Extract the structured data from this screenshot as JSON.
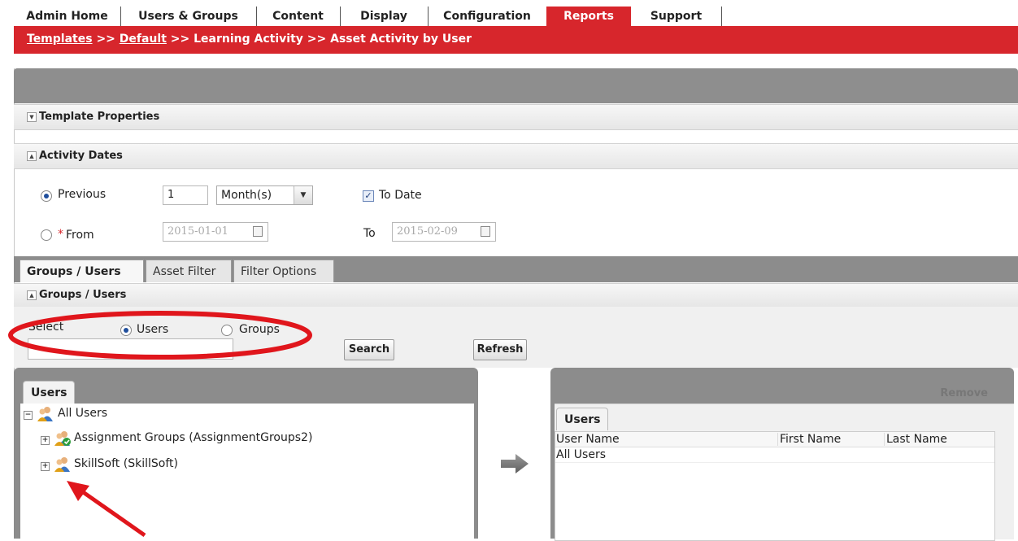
{
  "nav": {
    "tabs": [
      "Admin Home",
      "Users & Groups",
      "Content",
      "Display",
      "Configuration",
      "Reports",
      "Support"
    ],
    "active": "Reports"
  },
  "breadcrumb": {
    "templates": "Templates",
    "sep1": ">>",
    "default": "Default",
    "sep2": ">>",
    "learning": "Learning Activity",
    "sep3": ">>",
    "current": "Asset Activity by User"
  },
  "sections": {
    "template_properties": "Template Properties",
    "activity_dates": "Activity Dates",
    "groups_users": "Groups / Users"
  },
  "dates": {
    "previous_label": "Previous",
    "previous_value": "1",
    "period_selected": "Month(s)",
    "to_date_label": "To Date",
    "from_required": "*",
    "from_label": "From",
    "from_value": "2015-01-01",
    "to_label": "To",
    "to_value": "2015-02-09"
  },
  "tabs": [
    "Groups / Users",
    "Asset Filter",
    "Filter Options"
  ],
  "filter": {
    "select_label": "Select",
    "users_label": "Users",
    "groups_label": "Groups",
    "search_button": "Search",
    "refresh_button": "Refresh"
  },
  "left_panel": {
    "tab": "Users",
    "tree": [
      {
        "label": "All Users",
        "expander": "−"
      },
      {
        "label": "Assignment Groups (AssignmentGroups2)",
        "expander": "+"
      },
      {
        "label": "SkillSoft (SkillSoft)",
        "expander": "+"
      }
    ]
  },
  "right_panel": {
    "remove": "Remove",
    "tab": "Users",
    "columns": [
      "User Name",
      "First Name",
      "Last Name"
    ],
    "rows": [
      "All Users"
    ]
  },
  "colors": {
    "accent_red": "#d7262c",
    "panel_grey": "#8c8c8c",
    "annotation_red": "#e0161c"
  }
}
